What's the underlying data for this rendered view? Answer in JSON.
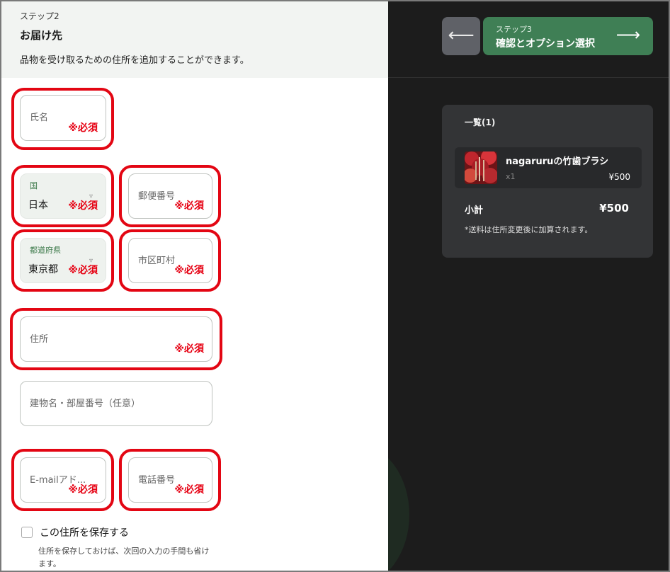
{
  "form": {
    "step_label": "ステップ2",
    "section_title": "お届け先",
    "description": "品物を受け取るための住所を追加することができます。",
    "required_mark": "※必須",
    "fields": {
      "name": {
        "label": "氏名"
      },
      "country": {
        "label": "国",
        "value": "日本"
      },
      "postal_code": {
        "label": "郵便番号"
      },
      "prefecture": {
        "label": "都道府県",
        "value": "東京都"
      },
      "city": {
        "label": "市区町村"
      },
      "address": {
        "label": "住所"
      },
      "building": {
        "label": "建物名・部屋番号（任意）"
      },
      "email": {
        "label": "E-mailアド..."
      },
      "phone": {
        "label": "電話番号"
      }
    },
    "save_address": {
      "label": "この住所を保存する",
      "help": "住所を保存しておけば、次回の入力の手間も省けます。"
    }
  },
  "nav": {
    "back_arrow": "⟵",
    "next_step_label": "ステップ3",
    "next_title": "確認とオプション選択",
    "next_arrow": "⟶"
  },
  "summary": {
    "title": "一覧(1)",
    "item": {
      "name": "nagaruruの竹歯ブラシ",
      "qty": "x1",
      "price": "¥500"
    },
    "subtotal_label": "小計",
    "subtotal_value": "¥500",
    "shipping_note": "*送料は住所変更後に加算されます。"
  },
  "colors": {
    "accent_green": "#3f7f55",
    "required_red": "#e60012",
    "highlight_red": "#e30613",
    "dark_bg": "#1c1c1c",
    "card_bg": "#333436"
  }
}
